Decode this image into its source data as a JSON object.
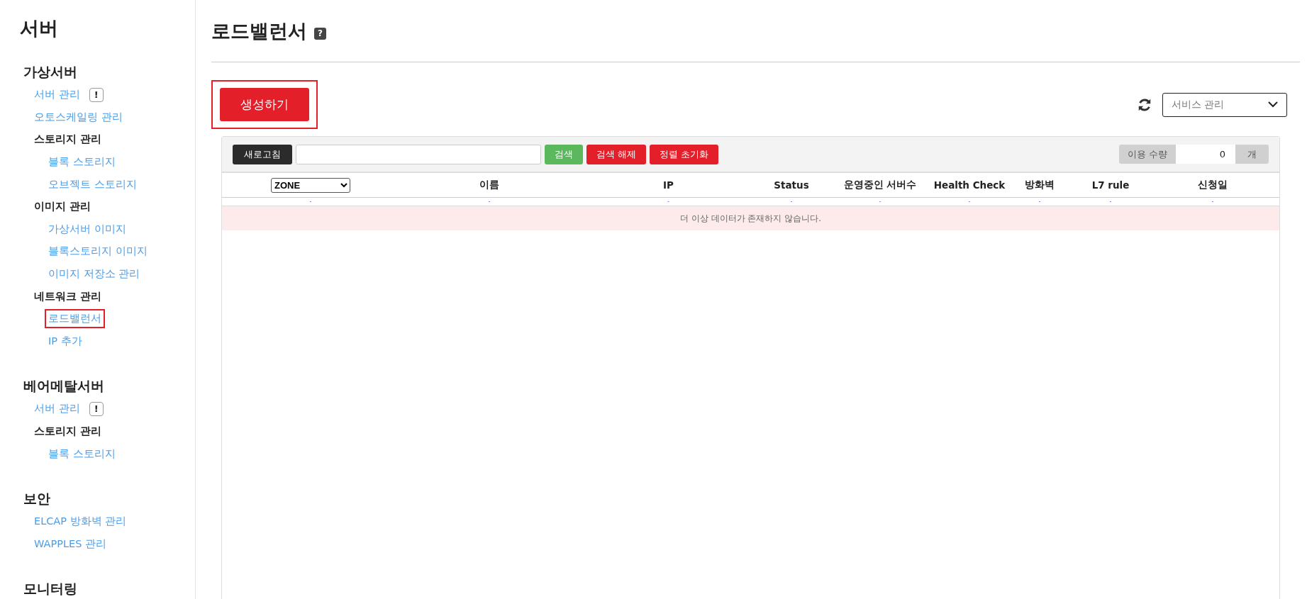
{
  "sidebar": {
    "title": "서버",
    "sections": [
      {
        "title": "가상서버",
        "items": [
          {
            "label": "서버 관리",
            "kind": "link",
            "badge": "!",
            "selected": false
          },
          {
            "label": "오토스케일링 관리",
            "kind": "link",
            "selected": false
          },
          {
            "label": "스토리지 관리",
            "kind": "group",
            "children": [
              {
                "label": "블록 스토리지",
                "selected": false
              },
              {
                "label": "오브젝트 스토리지",
                "selected": false
              }
            ]
          },
          {
            "label": "이미지 관리",
            "kind": "group",
            "children": [
              {
                "label": "가상서버 이미지",
                "selected": false
              },
              {
                "label": "블록스토리지 이미지",
                "selected": false
              },
              {
                "label": "이미지 저장소 관리",
                "selected": false
              }
            ]
          },
          {
            "label": "네트워크 관리",
            "kind": "group",
            "children": [
              {
                "label": "로드밸런서",
                "selected": true
              },
              {
                "label": "IP 추가",
                "selected": false
              }
            ]
          }
        ]
      },
      {
        "title": "베어메탈서버",
        "items": [
          {
            "label": "서버 관리",
            "kind": "link",
            "badge": "!",
            "selected": false
          },
          {
            "label": "스토리지 관리",
            "kind": "group",
            "children": [
              {
                "label": "블록 스토리지",
                "selected": false
              }
            ]
          }
        ]
      },
      {
        "title": "보안",
        "items": [
          {
            "label": "ELCAP 방화벽 관리",
            "kind": "link",
            "selected": false
          },
          {
            "label": "WAPPLES 관리",
            "kind": "link",
            "selected": false
          }
        ]
      },
      {
        "title": "모니터링"
      }
    ]
  },
  "page": {
    "title": "로드밸런서",
    "help": "?"
  },
  "create_button": {
    "label": "생성하기",
    "highlighted": true
  },
  "service_dropdown": {
    "value": "서비스 관리"
  },
  "toolbar": {
    "refresh_button": "새로고침",
    "buttons": [
      {
        "label": "검색",
        "kind": "confirm"
      },
      {
        "label": "검색 해제",
        "kind": "danger"
      },
      {
        "label": "정렬 초기화",
        "kind": "danger"
      }
    ],
    "usage": {
      "label": "이용 수량",
      "value": "0",
      "unit": "개"
    }
  },
  "table": {
    "zone_filter": "ZONE",
    "columns": [
      "이름",
      "IP",
      "Status",
      "운영중인 서버수",
      "Health Check",
      "방화벽",
      "L7 rule",
      "신청일"
    ],
    "placeholder_row": [
      "-",
      "-",
      "-",
      "-",
      "-",
      "-",
      "-",
      "-",
      "-"
    ],
    "empty_message": "더 이상 데이터가 존재하지 않습니다."
  }
}
